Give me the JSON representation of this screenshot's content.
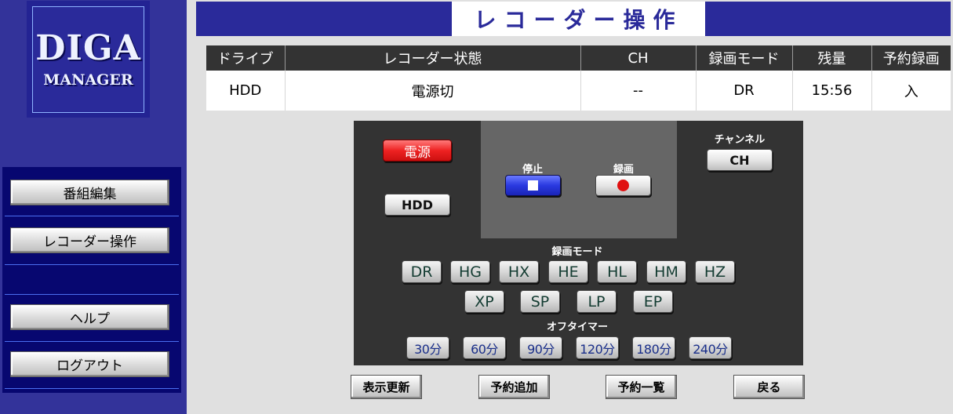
{
  "logo": {
    "line1": "DIGA",
    "line2": "MANAGER"
  },
  "nav": {
    "items": [
      {
        "label": "番組編集"
      },
      {
        "label": "レコーダー操作"
      },
      {
        "label": "ヘルプ"
      },
      {
        "label": "ログアウト"
      }
    ]
  },
  "header": {
    "title": "レコーダー操作"
  },
  "status": {
    "headers": [
      "ドライブ",
      "レコーダー状態",
      "CH",
      "録画モード",
      "残量",
      "予約録画"
    ],
    "row": [
      "HDD",
      "電源切",
      "--",
      "DR",
      "15:56",
      "入"
    ]
  },
  "remote": {
    "power_label": "電源",
    "drive_label": "HDD",
    "stop_label": "停止",
    "rec_label": "録画",
    "channel_label": "チャンネル",
    "channel_button": "CH",
    "mode_label": "録画モード",
    "modes_row1": [
      "DR",
      "HG",
      "HX",
      "HE",
      "HL",
      "HM",
      "HZ"
    ],
    "modes_row2": [
      "XP",
      "SP",
      "LP",
      "EP"
    ],
    "timer_label": "オフタイマー",
    "timers": [
      "30分",
      "60分",
      "90分",
      "120分",
      "180分",
      "240分"
    ]
  },
  "bottom": {
    "refresh": "表示更新",
    "add_reservation": "予約追加",
    "reservation_list": "予約一覧",
    "back": "戻る"
  },
  "colors": {
    "navy": "#2a2a9a",
    "sidebar": "#33339a",
    "panel": "#333333",
    "power": "#ee2222",
    "stop": "#2a3ae0"
  }
}
